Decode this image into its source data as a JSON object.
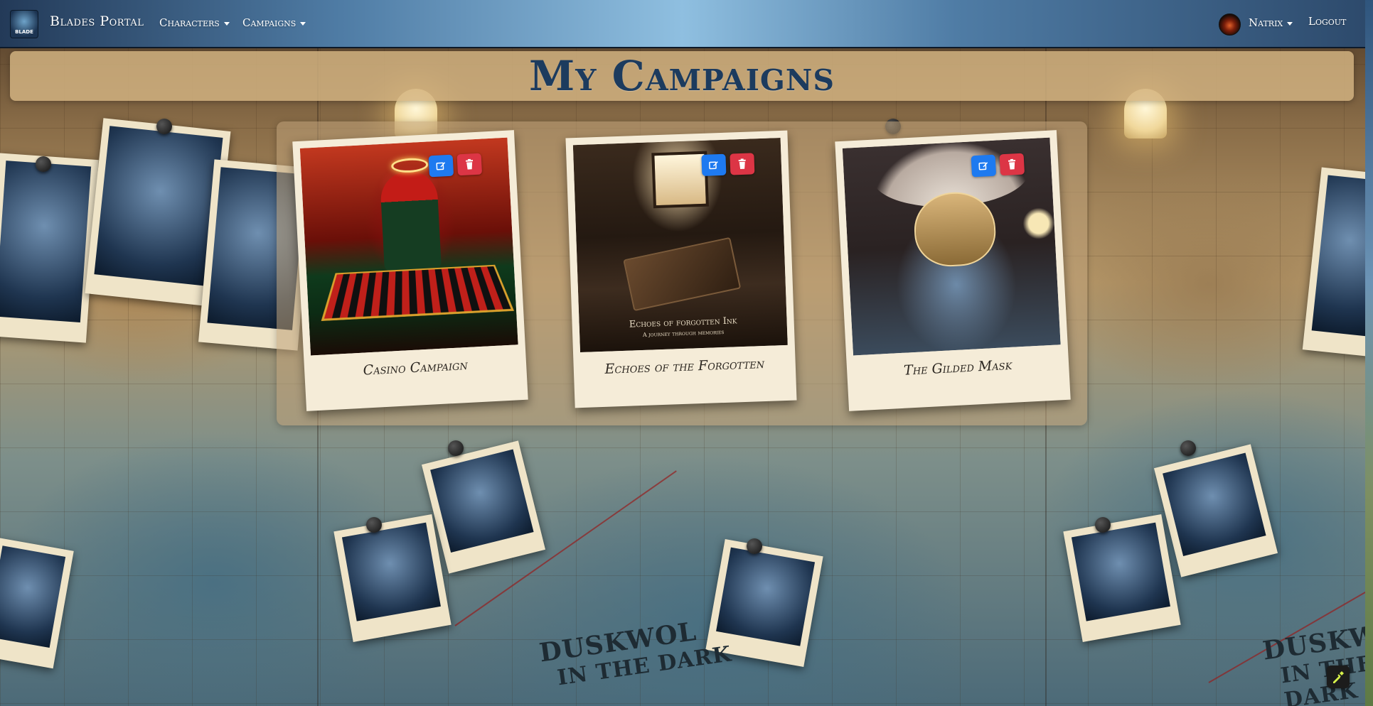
{
  "nav": {
    "brand_logo_text": "BLADE",
    "brand": "Blades Portal",
    "items": [
      {
        "label": "Characters"
      },
      {
        "label": "Campaigns"
      }
    ],
    "user": "Natrix",
    "logout": "Logout"
  },
  "page": {
    "title": "My Campaigns"
  },
  "campaigns": [
    {
      "title": "Casino Campaign"
    },
    {
      "title": "Echoes of the Forgotten",
      "cover_text": "Echoes of forgotten Ink",
      "cover_subtext": "A journey through memories"
    },
    {
      "title": "The Gilded Mask"
    }
  ],
  "background": {
    "map_label": "Duskwol in the Dark",
    "map_label_line1": "DUSKWOL",
    "map_label_line2": "IN THE DARK"
  },
  "colors": {
    "edit_button": "#1e7af0",
    "delete_button": "#dc3545",
    "title": "#1c3b5e"
  },
  "icons": {
    "edit": "pencil-square-icon",
    "delete": "trash-icon",
    "widget": "eyedropper-icon"
  }
}
